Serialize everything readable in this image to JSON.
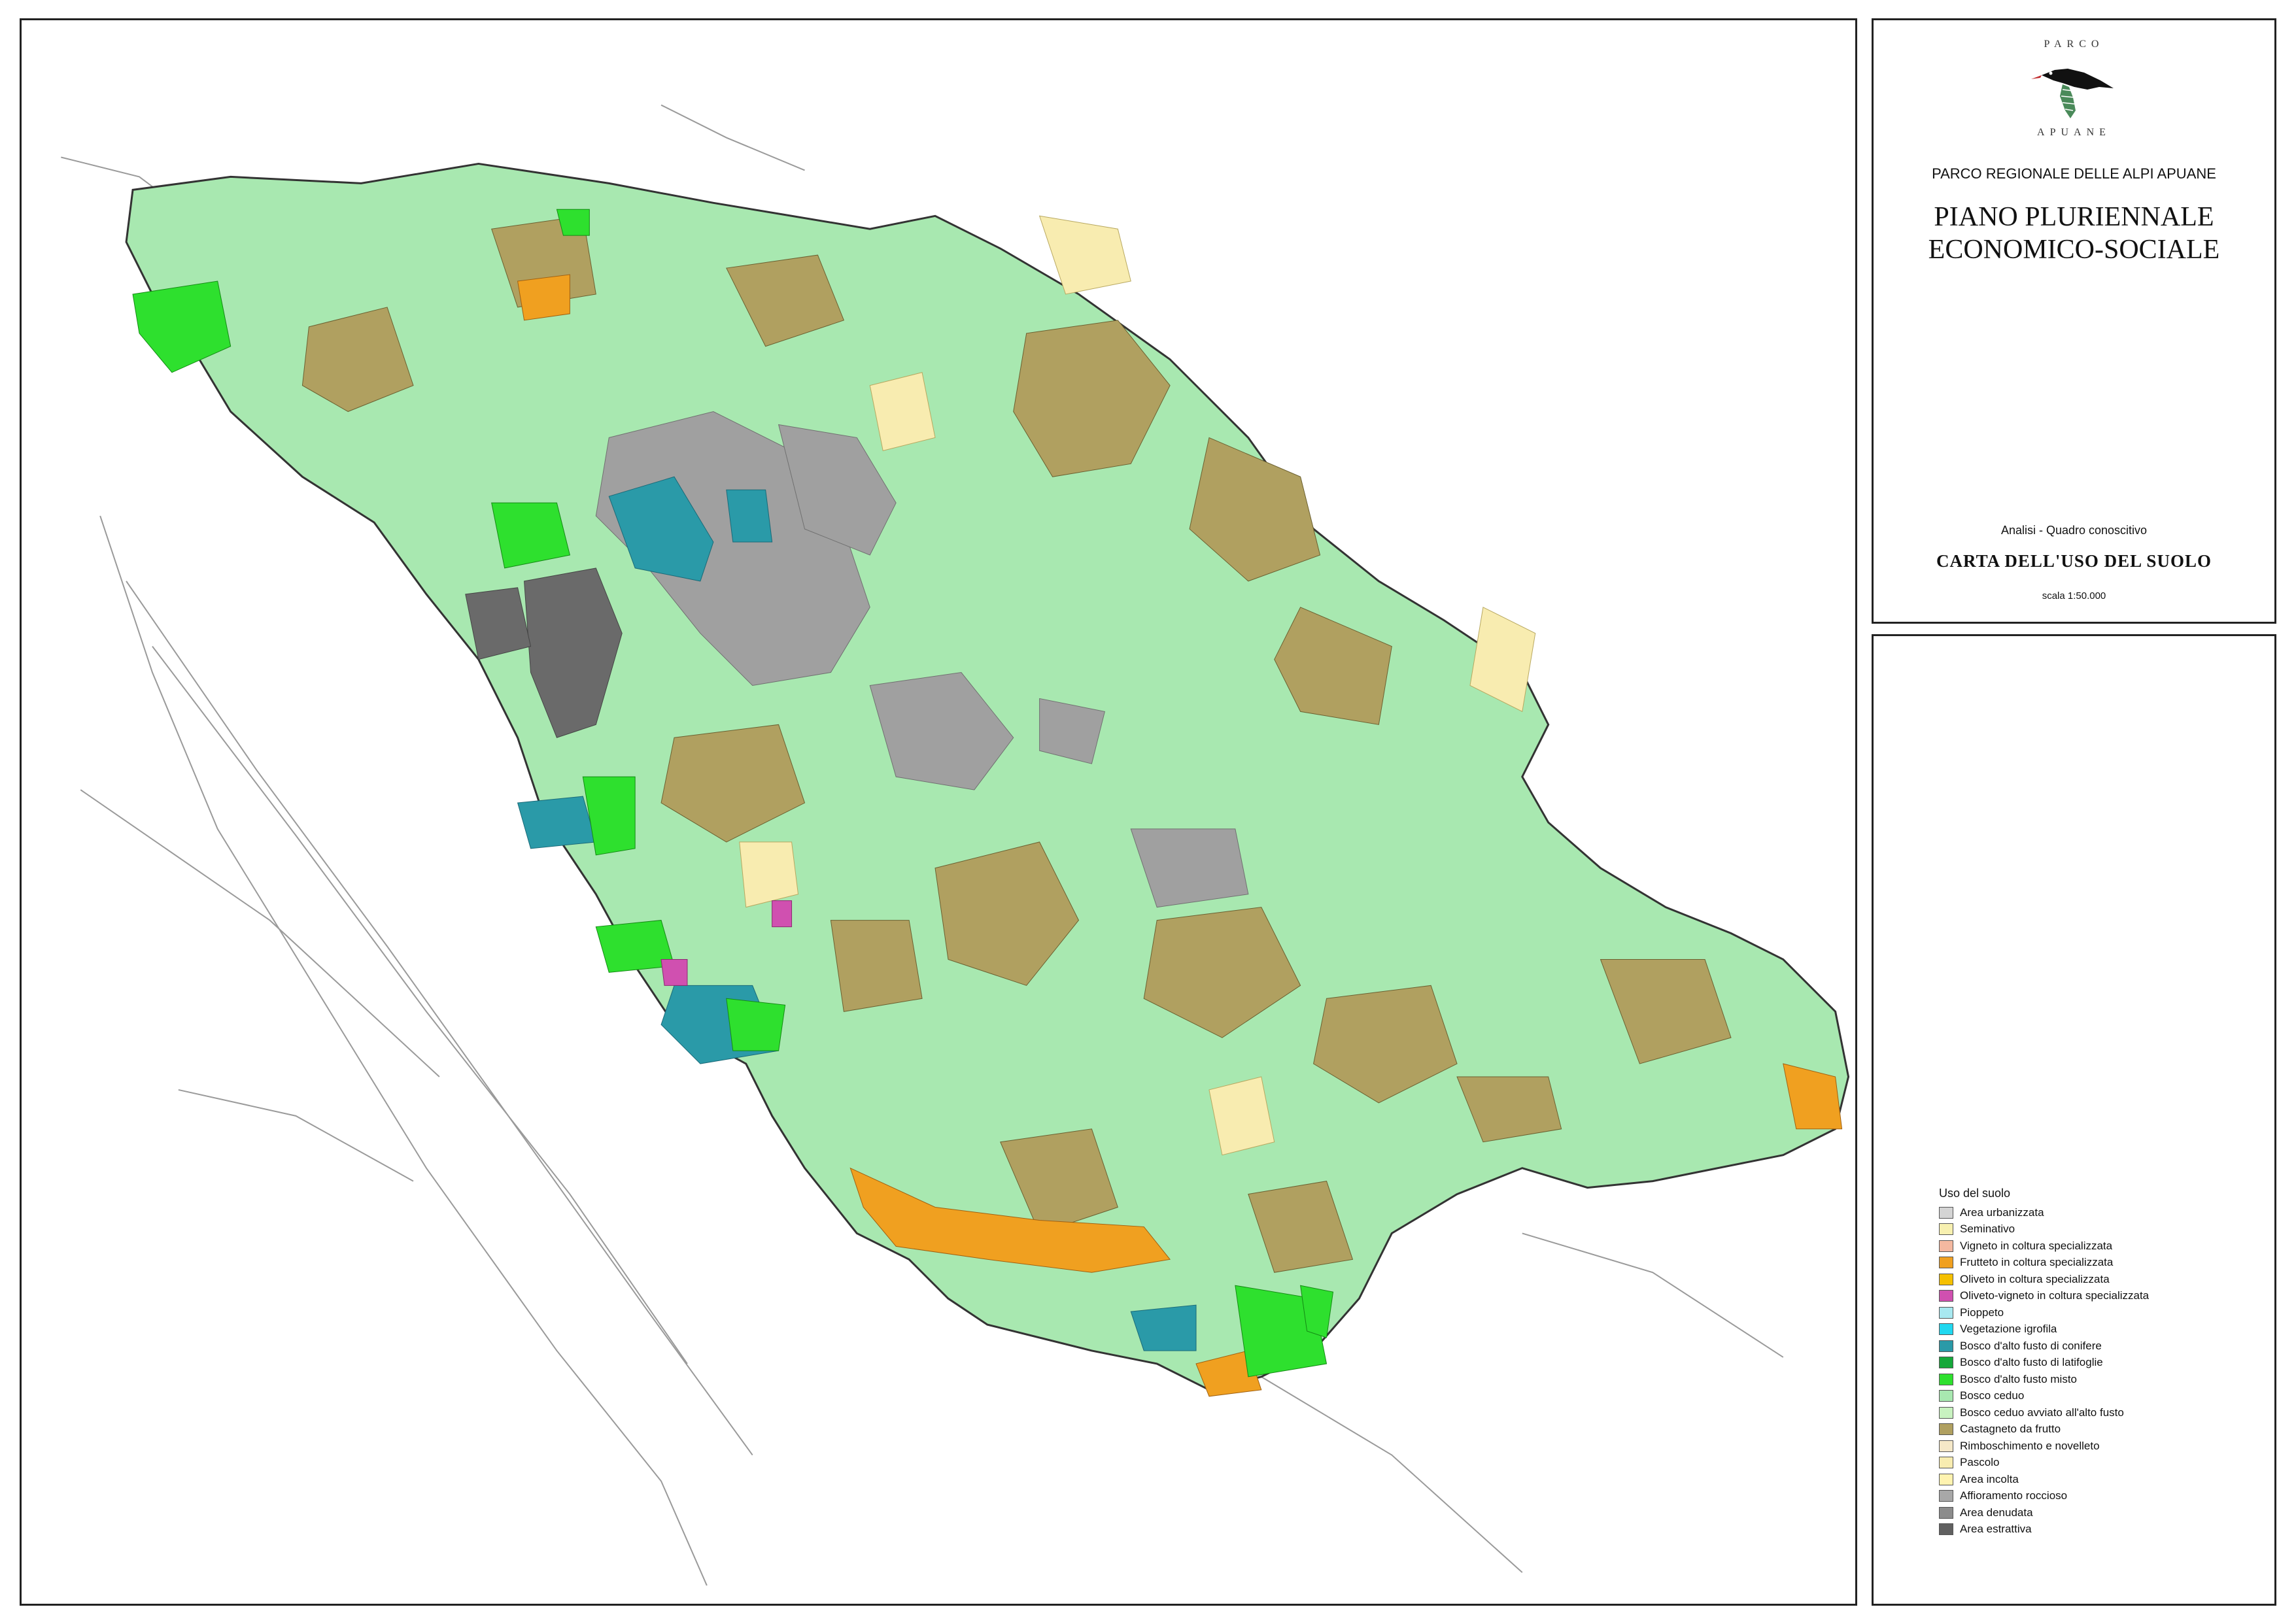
{
  "header": {
    "logo_top": "PARCO",
    "logo_bottom": "APUANE",
    "park_name": "PARCO REGIONALE DELLE ALPI APUANE",
    "plan_title_line1": "PIANO PLURIENNALE",
    "plan_title_line2": "ECONOMICO-SOCIALE",
    "analysis": "Analisi - Quadro conoscitivo",
    "map_title": "CARTA DELL'USO DEL SUOLO",
    "scale": "scala 1:50.000"
  },
  "legend": {
    "title": "Uso del suolo",
    "items": [
      {
        "label": "Area urbanizzata",
        "color": "#d4d4d4"
      },
      {
        "label": "Seminativo",
        "color": "#f7f0b0"
      },
      {
        "label": "Vigneto in coltura specializzata",
        "color": "#f4b8a0"
      },
      {
        "label": "Frutteto in coltura specializzata",
        "color": "#f0a020"
      },
      {
        "label": "Oliveto in coltura specializzata",
        "color": "#f5c000"
      },
      {
        "label": "Oliveto-vigneto in coltura specializzata",
        "color": "#d050b0"
      },
      {
        "label": "Pioppeto",
        "color": "#a8e8f0"
      },
      {
        "label": "Vegetazione igrofila",
        "color": "#20d8f0"
      },
      {
        "label": "Bosco d'alto fusto di conifere",
        "color": "#2a9aa8"
      },
      {
        "label": "Bosco d'alto fusto di latifoglie",
        "color": "#16a83a"
      },
      {
        "label": "Bosco d'alto fusto misto",
        "color": "#2ee02e"
      },
      {
        "label": "Bosco ceduo",
        "color": "#a8e8b0"
      },
      {
        "label": "Bosco ceduo avviato all'alto fusto",
        "color": "#c8f2c0"
      },
      {
        "label": "Castagneto da frutto",
        "color": "#b0a060"
      },
      {
        "label": "Rimboschimento e novelleto",
        "color": "#f5e8c8"
      },
      {
        "label": "Pascolo",
        "color": "#f8ecb0"
      },
      {
        "label": "Area incolta",
        "color": "#fff3b0"
      },
      {
        "label": "Affioramento roccioso",
        "color": "#a8a8a8"
      },
      {
        "label": "Area denudata",
        "color": "#8c8c8c"
      },
      {
        "label": "Area estrattiva",
        "color": "#606060"
      }
    ]
  },
  "map_colors": {
    "park": "#a8e8b0",
    "chestnut": "#b0a060",
    "rock": "#a0a0a0",
    "quarry": "#6a6a6a",
    "pasture": "#f8ecb0",
    "orchard": "#f0a020",
    "conifer": "#2a9aa8",
    "mixed": "#2ee02e",
    "olive_vine": "#d050b0",
    "base_lines": "#999999"
  }
}
